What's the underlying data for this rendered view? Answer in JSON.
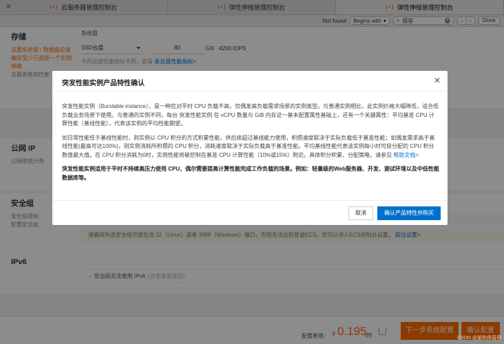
{
  "tabs": [
    {
      "label": "云服务器管理控制台",
      "active": false
    },
    {
      "label": "弹性伸缩管理控制台",
      "active": false
    },
    {
      "label": "弹性伸缩管理控制台",
      "active": true
    }
  ],
  "findbar": {
    "status": "Not found",
    "mode": "Begins with",
    "query": "保存",
    "prev": "‹",
    "next": "›",
    "done": "Done"
  },
  "storage": {
    "title": "存储",
    "orange_desc": "设置系统盘 / 数据盘前请确保至少已选择一个实例规格",
    "desc": "云盘参数和性能",
    "sysdisk_label": "系统盘",
    "disk_type": "SSD云盘",
    "size": "80",
    "unit": "GiB",
    "iops": "4200 IOPS",
    "hint": "不同云盘性能指标不同，查看",
    "hint_link": "各云盘性能指标>"
  },
  "public_ip": {
    "title": "公网 IP",
    "desc": "公网带宽计费"
  },
  "security": {
    "title": "安全组",
    "desc1": "安全组限制",
    "desc2": "配置安全组",
    "notice": "请确保所选安全组开放包含 22（Linux）或者 3389（Windows）端口，否则无法远程登录ECS。您可以进入ECS控制台设置。",
    "notice_link": "前往设置>"
  },
  "ipv6": {
    "title": "IPv6",
    "row_text": "您当前无法使用 IPv6",
    "row_sub": "(点击查看原因)"
  },
  "footer": {
    "fee_label": "配置费用：",
    "currency": "¥",
    "price": "0.195",
    "per": "/时",
    "next_button": "下一步系统配置",
    "confirm_button": "确认配置"
  },
  "modal": {
    "title": "突发性能实例产品特性确认",
    "p1": "突发性能实例（Burstable instance），是一种应对平时 CPU 负载不高，仅偶发高负载需求场景的实例类型。与普通实例相比，此实例价格大幅降低，适合低负载业务场景下使用。与普通的实例不同，每台 突发性能实例 在 vCPU 数量与 GiB 内存这一基本配置属性基础上，还有一个关键属性：平均基准 CPU 计算性能（基线性能），代表该实例的平均性能期望。",
    "p2": "如日常性能低于基线性能时，则实例以 CPU 积分的方式积累性能，供后续超过基线能力使用，积攒速度取决于实际负载低于基准性能；如偶发需求高于基线性能(最高可达100%)，则实例消耗所积攒的 CPU 积分，消耗速度取决于实际负载高于基准性能。平均基线性能代表该实例每小时可获分配的 CPU 积分数值最大值。在 CPU 积分消耗为0时，实例性能将被控制在基准 CPU 计算性能（10%或15%）附近。具体积分积累、分配策略，请参见",
    "p2_link": "帮助文档>",
    "p3": "突发性能实例适用于平时不持续高压力使用 CPU、偶尔需要提高计算性能完成工作负载的场景。例如：轻量级的Web服务器、开发、测试环境以及中低性能数据库等。",
    "cancel": "取消",
    "ok": "确认产品特性并购买"
  },
  "watermark": "CSDN @架构师易哥",
  "colors": {
    "accent": "#ff6a00",
    "link": "#0070cc",
    "overlay": "rgba(0,0,0,0.45)"
  }
}
